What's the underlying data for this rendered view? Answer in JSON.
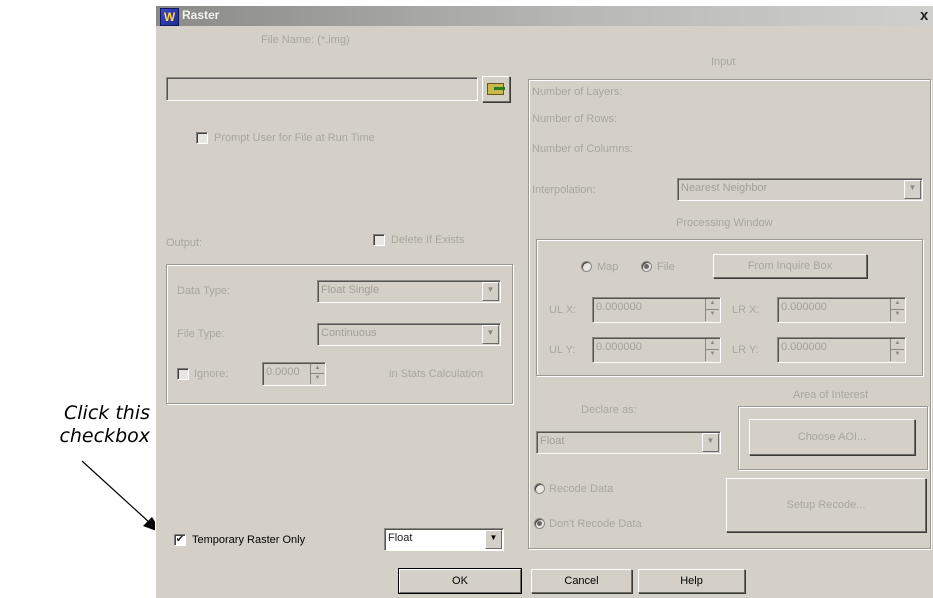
{
  "callout": {
    "line1": "Click this",
    "line2": "checkbox"
  },
  "window": {
    "title": "Raster",
    "close_glyph": "x",
    "icon": "app-logo-icon"
  },
  "file": {
    "label": "File Name: (*.img)",
    "value": "",
    "browse_icon": "folder-open-icon",
    "prompt_label": "Prompt User for File at Run Time"
  },
  "output": {
    "label": "Output:",
    "delete_label": "Delete If Exists",
    "data_type_label": "Data Type:",
    "data_type_value": "Float Single",
    "file_type_label": "File Type:",
    "file_type_value": "Continuous",
    "ignore_label": "Ignore:",
    "ignore_value": "0.0000",
    "stats_label": "in Stats Calculation"
  },
  "temporary": {
    "label": "Temporary Raster Only",
    "checked": true,
    "type_value": "Float"
  },
  "input": {
    "label": "Input",
    "layers_label": "Number of Layers:",
    "rows_label": "Number of Rows:",
    "cols_label": "Number of Columns:",
    "interp_label": "Interpolation:",
    "interp_value": "Nearest Neighbor",
    "proc_window_label": "Processing Window",
    "map_label": "Map",
    "file_label": "File",
    "from_inquire_label": "From Inquire Box",
    "ulx_label": "UL X:",
    "ulx_value": "0.000000",
    "lrx_label": "LR X:",
    "lrx_value": "0.000000",
    "uly_label": "UL Y:",
    "uly_value": "0.000000",
    "lry_label": "LR Y:",
    "lry_value": "0.000000",
    "declare_label": "Declare as:",
    "declare_value": "Float",
    "aoi_label": "Area of Interest",
    "choose_aoi_label": "Choose AOI...",
    "recode_label": "Recode Data",
    "dont_recode_label": "Don't Recode Data",
    "setup_recode_label": "Setup Recode..."
  },
  "buttons": {
    "ok": "OK",
    "cancel": "Cancel",
    "help": "Help"
  },
  "glyphs": {
    "check": "✔",
    "down": "▼",
    "up": "▲"
  }
}
